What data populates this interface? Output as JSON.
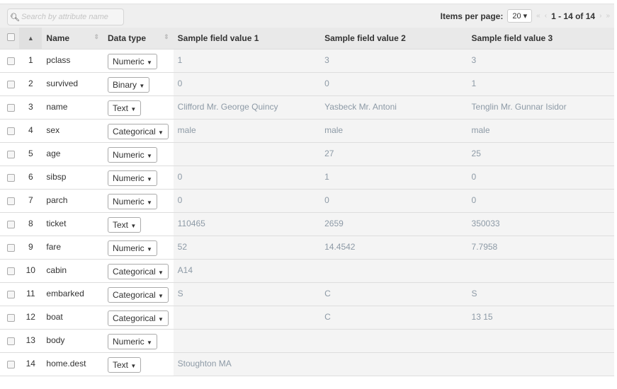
{
  "toolbar": {
    "search_placeholder": "Search by attribute name",
    "items_per_page_label": "Items per page:",
    "items_per_page": "20",
    "range": "1 - 14 of 14"
  },
  "headers": {
    "name": "Name",
    "data_type": "Data type",
    "s1": "Sample field value 1",
    "s2": "Sample field value 2",
    "s3": "Sample field value 3"
  },
  "rows": [
    {
      "n": "1",
      "name": "pclass",
      "type": "Numeric",
      "s1": "1",
      "s2": "3",
      "s3": "3"
    },
    {
      "n": "2",
      "name": "survived",
      "type": "Binary",
      "s1": "0",
      "s2": "0",
      "s3": "1"
    },
    {
      "n": "3",
      "name": "name",
      "type": "Text",
      "s1": "Clifford Mr. George Quincy",
      "s2": "Yasbeck Mr. Antoni",
      "s3": "Tenglin Mr. Gunnar Isidor"
    },
    {
      "n": "4",
      "name": "sex",
      "type": "Categorical",
      "s1": "male",
      "s2": "male",
      "s3": "male"
    },
    {
      "n": "5",
      "name": "age",
      "type": "Numeric",
      "s1": "",
      "s2": "27",
      "s3": "25"
    },
    {
      "n": "6",
      "name": "sibsp",
      "type": "Numeric",
      "s1": "0",
      "s2": "1",
      "s3": "0"
    },
    {
      "n": "7",
      "name": "parch",
      "type": "Numeric",
      "s1": "0",
      "s2": "0",
      "s3": "0"
    },
    {
      "n": "8",
      "name": "ticket",
      "type": "Text",
      "s1": "110465",
      "s2": "2659",
      "s3": "350033"
    },
    {
      "n": "9",
      "name": "fare",
      "type": "Numeric",
      "s1": "52",
      "s2": "14.4542",
      "s3": "7.7958"
    },
    {
      "n": "10",
      "name": "cabin",
      "type": "Categorical",
      "s1": "A14",
      "s2": "",
      "s3": ""
    },
    {
      "n": "11",
      "name": "embarked",
      "type": "Categorical",
      "s1": "S",
      "s2": "C",
      "s3": "S"
    },
    {
      "n": "12",
      "name": "boat",
      "type": "Categorical",
      "s1": "",
      "s2": "C",
      "s3": "13 15"
    },
    {
      "n": "13",
      "name": "body",
      "type": "Numeric",
      "s1": "",
      "s2": "",
      "s3": ""
    },
    {
      "n": "14",
      "name": "home.dest",
      "type": "Text",
      "s1": "Stoughton MA",
      "s2": "",
      "s3": ""
    }
  ]
}
